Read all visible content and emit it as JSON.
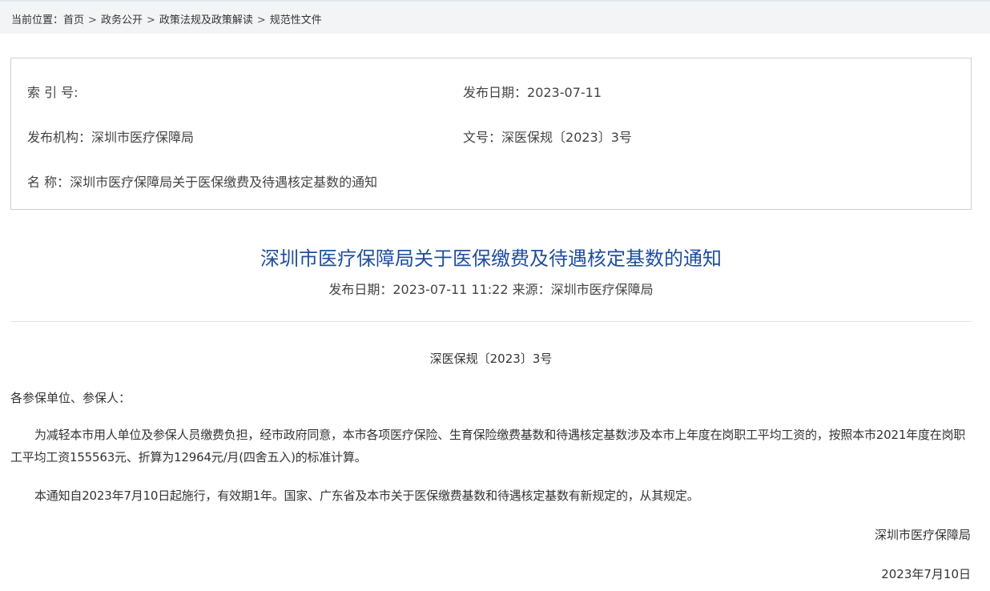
{
  "breadcrumb": {
    "prefix": "当前位置：",
    "items": [
      "首页",
      "政务公开",
      "政策法规及政策解读",
      "规范性文件"
    ],
    "separator": ">"
  },
  "meta": {
    "index_label": "索 引 号:",
    "index_value": "",
    "publish_date_label": "发布日期：",
    "publish_date": "2023-07-11",
    "agency_label": "发布机构：",
    "agency": "深圳市医疗保障局",
    "doc_no_label": "文号：",
    "doc_no": "深医保规〔2023〕3号",
    "name_label": "名 称：",
    "name": "深圳市医疗保障局关于医保缴费及待遇核定基数的通知"
  },
  "article": {
    "title": "深圳市医疗保障局关于医保缴费及待遇核定基数的通知",
    "date_label": "发布日期：",
    "datetime": "2023-07-11 11:22",
    "source_label": "来源：",
    "source": "深圳市医疗保障局",
    "doc_no": "深医保规〔2023〕3号",
    "salutation": "各参保单位、参保人：",
    "paragraphs": [
      "为减轻本市用人单位及参保人员缴费负担，经市政府同意，本市各项医疗保险、生育保险缴费基数和待遇核定基数涉及本市上年度在岗职工平均工资的，按照本市2021年度在岗职工平均工资155563元、折算为12964元/月(四舍五入)的标准计算。",
      "本通知自2023年7月10日起施行，有效期1年。国家、广东省及本市关于医保缴费基数和待遇核定基数有新规定的，从其规定。"
    ],
    "signature": "深圳市医疗保障局",
    "sign_date": "2023年7月10日"
  }
}
